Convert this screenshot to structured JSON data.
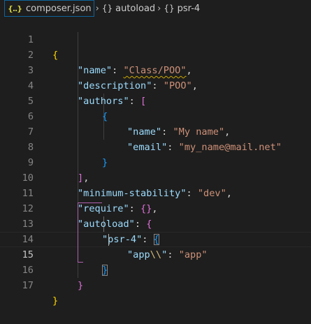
{
  "breadcrumb": {
    "items": [
      {
        "icon": "json-file-icon",
        "glyph": "{..}",
        "label": "composer.json"
      },
      {
        "icon": "braces-icon",
        "glyph": "{}",
        "label": "autoload"
      },
      {
        "icon": "braces-icon",
        "glyph": "{}",
        "label": "psr-4"
      }
    ],
    "separator": "›"
  },
  "editor": {
    "active_line": 15,
    "lines": [
      {
        "num": "1"
      },
      {
        "num": "2"
      },
      {
        "num": "3"
      },
      {
        "num": "4"
      },
      {
        "num": "5"
      },
      {
        "num": "6"
      },
      {
        "num": "7"
      },
      {
        "num": "8"
      },
      {
        "num": "9"
      },
      {
        "num": "10"
      },
      {
        "num": "11"
      },
      {
        "num": "12"
      },
      {
        "num": "13"
      },
      {
        "num": "14"
      },
      {
        "num": "15"
      },
      {
        "num": "16"
      },
      {
        "num": "17"
      }
    ],
    "tokens": {
      "key_name": "\"name\"",
      "val_name": "\"Class/POO\"",
      "key_description": "\"description\"",
      "val_description": "\"POO\"",
      "key_authors": "\"authors\"",
      "key_author_name": "\"name\"",
      "val_author_name": "\"My name\"",
      "key_author_email": "\"email\"",
      "val_author_email": "\"my_name@mail.net\"",
      "key_minimum_stability": "\"minimum-stability\"",
      "val_minimum_stability": "\"dev\"",
      "key_require": "\"require\"",
      "key_autoload": "\"autoload\"",
      "key_psr4": "\"psr-4\"",
      "key_app_prefix": "\"app",
      "key_app_escape": "\\\\",
      "key_app_suffix": "\"",
      "val_app": "\"app\"",
      "open_brace": "{",
      "close_brace": "}",
      "open_bracket": "[",
      "close_bracket": "]",
      "colon": ": ",
      "comma": ",",
      "empty_object": "{}"
    }
  },
  "colors": {
    "background": "#1e1e1e",
    "key": "#9cdcfe",
    "string": "#ce9178",
    "escape": "#d7ba7d",
    "bracket_level1": "#ffd700",
    "bracket_level2": "#da70d6",
    "bracket_level3": "#179fff",
    "line_number": "#858585",
    "warning_squiggle": "#cca700"
  }
}
